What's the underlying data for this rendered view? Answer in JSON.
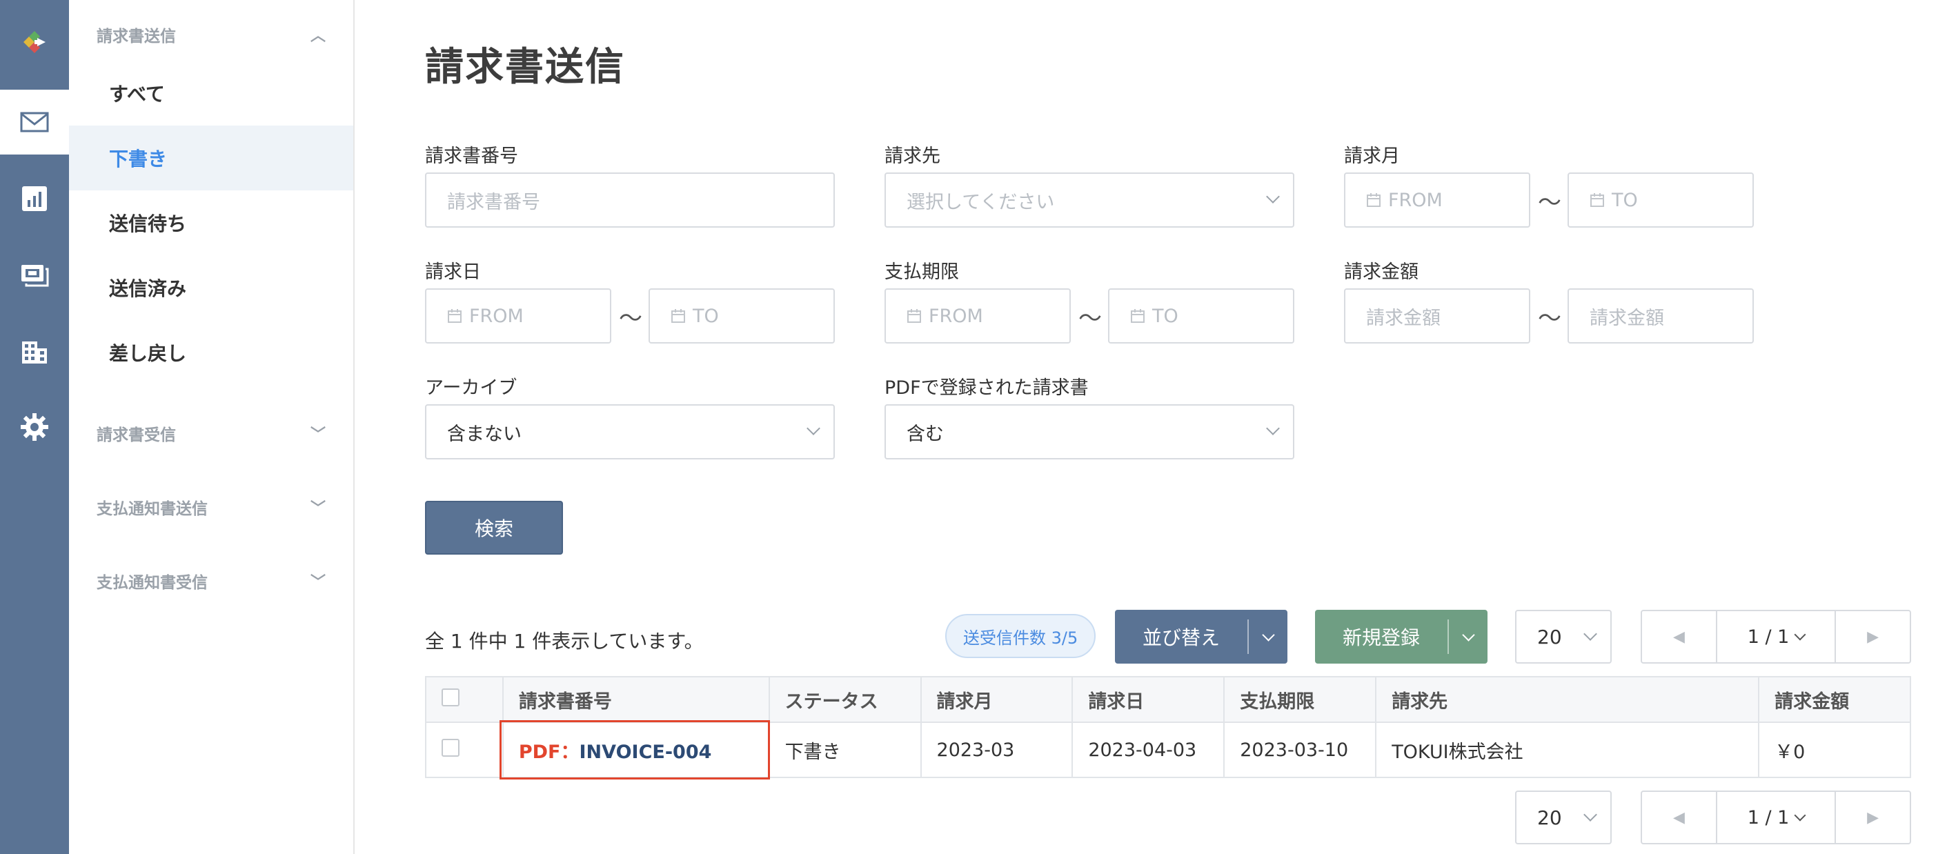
{
  "sidebar": {
    "groups": [
      {
        "label": "請求書送信",
        "chevron": "^"
      },
      {
        "label": "請求書受信",
        "chevron": "⌄"
      },
      {
        "label": "支払通知書送信",
        "chevron": "⌄"
      },
      {
        "label": "支払通知書受信",
        "chevron": "⌄"
      }
    ],
    "items": [
      {
        "label": "すべて"
      },
      {
        "label": "下書き"
      },
      {
        "label": "送信待ち"
      },
      {
        "label": "送信済み"
      },
      {
        "label": "差し戻し"
      }
    ],
    "active_item": "下書き"
  },
  "rail": {
    "icons": [
      "logo-icon",
      "mail-icon",
      "chart-icon",
      "payment-icon",
      "building-icon",
      "gear-icon"
    ]
  },
  "page": {
    "title": "請求書送信"
  },
  "filters": {
    "invoice_number": {
      "label": "請求書番号",
      "placeholder": "請求書番号"
    },
    "billing_to": {
      "label": "請求先",
      "placeholder": "選択してください"
    },
    "billing_month": {
      "label": "請求月",
      "from": "FROM",
      "to": "TO"
    },
    "billing_date": {
      "label": "請求日",
      "from": "FROM",
      "to": "TO"
    },
    "due_date": {
      "label": "支払期限",
      "from": "FROM",
      "to": "TO"
    },
    "amount": {
      "label": "請求金額",
      "from": "請求金額",
      "to": "請求金額"
    },
    "archive": {
      "label": "アーカイブ",
      "value": "含まない"
    },
    "pdf_registered": {
      "label": "PDFで登録された請求書",
      "value": "含む"
    },
    "tilde": "〜",
    "search_button": "検索"
  },
  "results": {
    "summary": "全 1 件中 1 件表示しています。",
    "badge": "送受信件数 3/5",
    "sort_button": "並び替え",
    "new_button": "新規登録",
    "per_page": "20",
    "page_label": "1 / 1",
    "prev": "◀",
    "next": "▶"
  },
  "table": {
    "headers": [
      "請求書番号",
      "ステータス",
      "請求月",
      "請求日",
      "支払期限",
      "請求先",
      "請求金額"
    ],
    "rows": [
      {
        "number_prefix": "PDF：",
        "number": "INVOICE-004",
        "status": "下書き",
        "month": "2023-03",
        "date": "2023-04-03",
        "due": "2023-03-10",
        "client": "TOKUI株式会社",
        "amount": "￥0"
      }
    ]
  },
  "colors": {
    "rail_bg": "#5a7394",
    "active_nav": "#3e8ae6",
    "search_btn": "#5a7394",
    "new_btn": "#6f9e83",
    "highlight": "#e2452d"
  }
}
